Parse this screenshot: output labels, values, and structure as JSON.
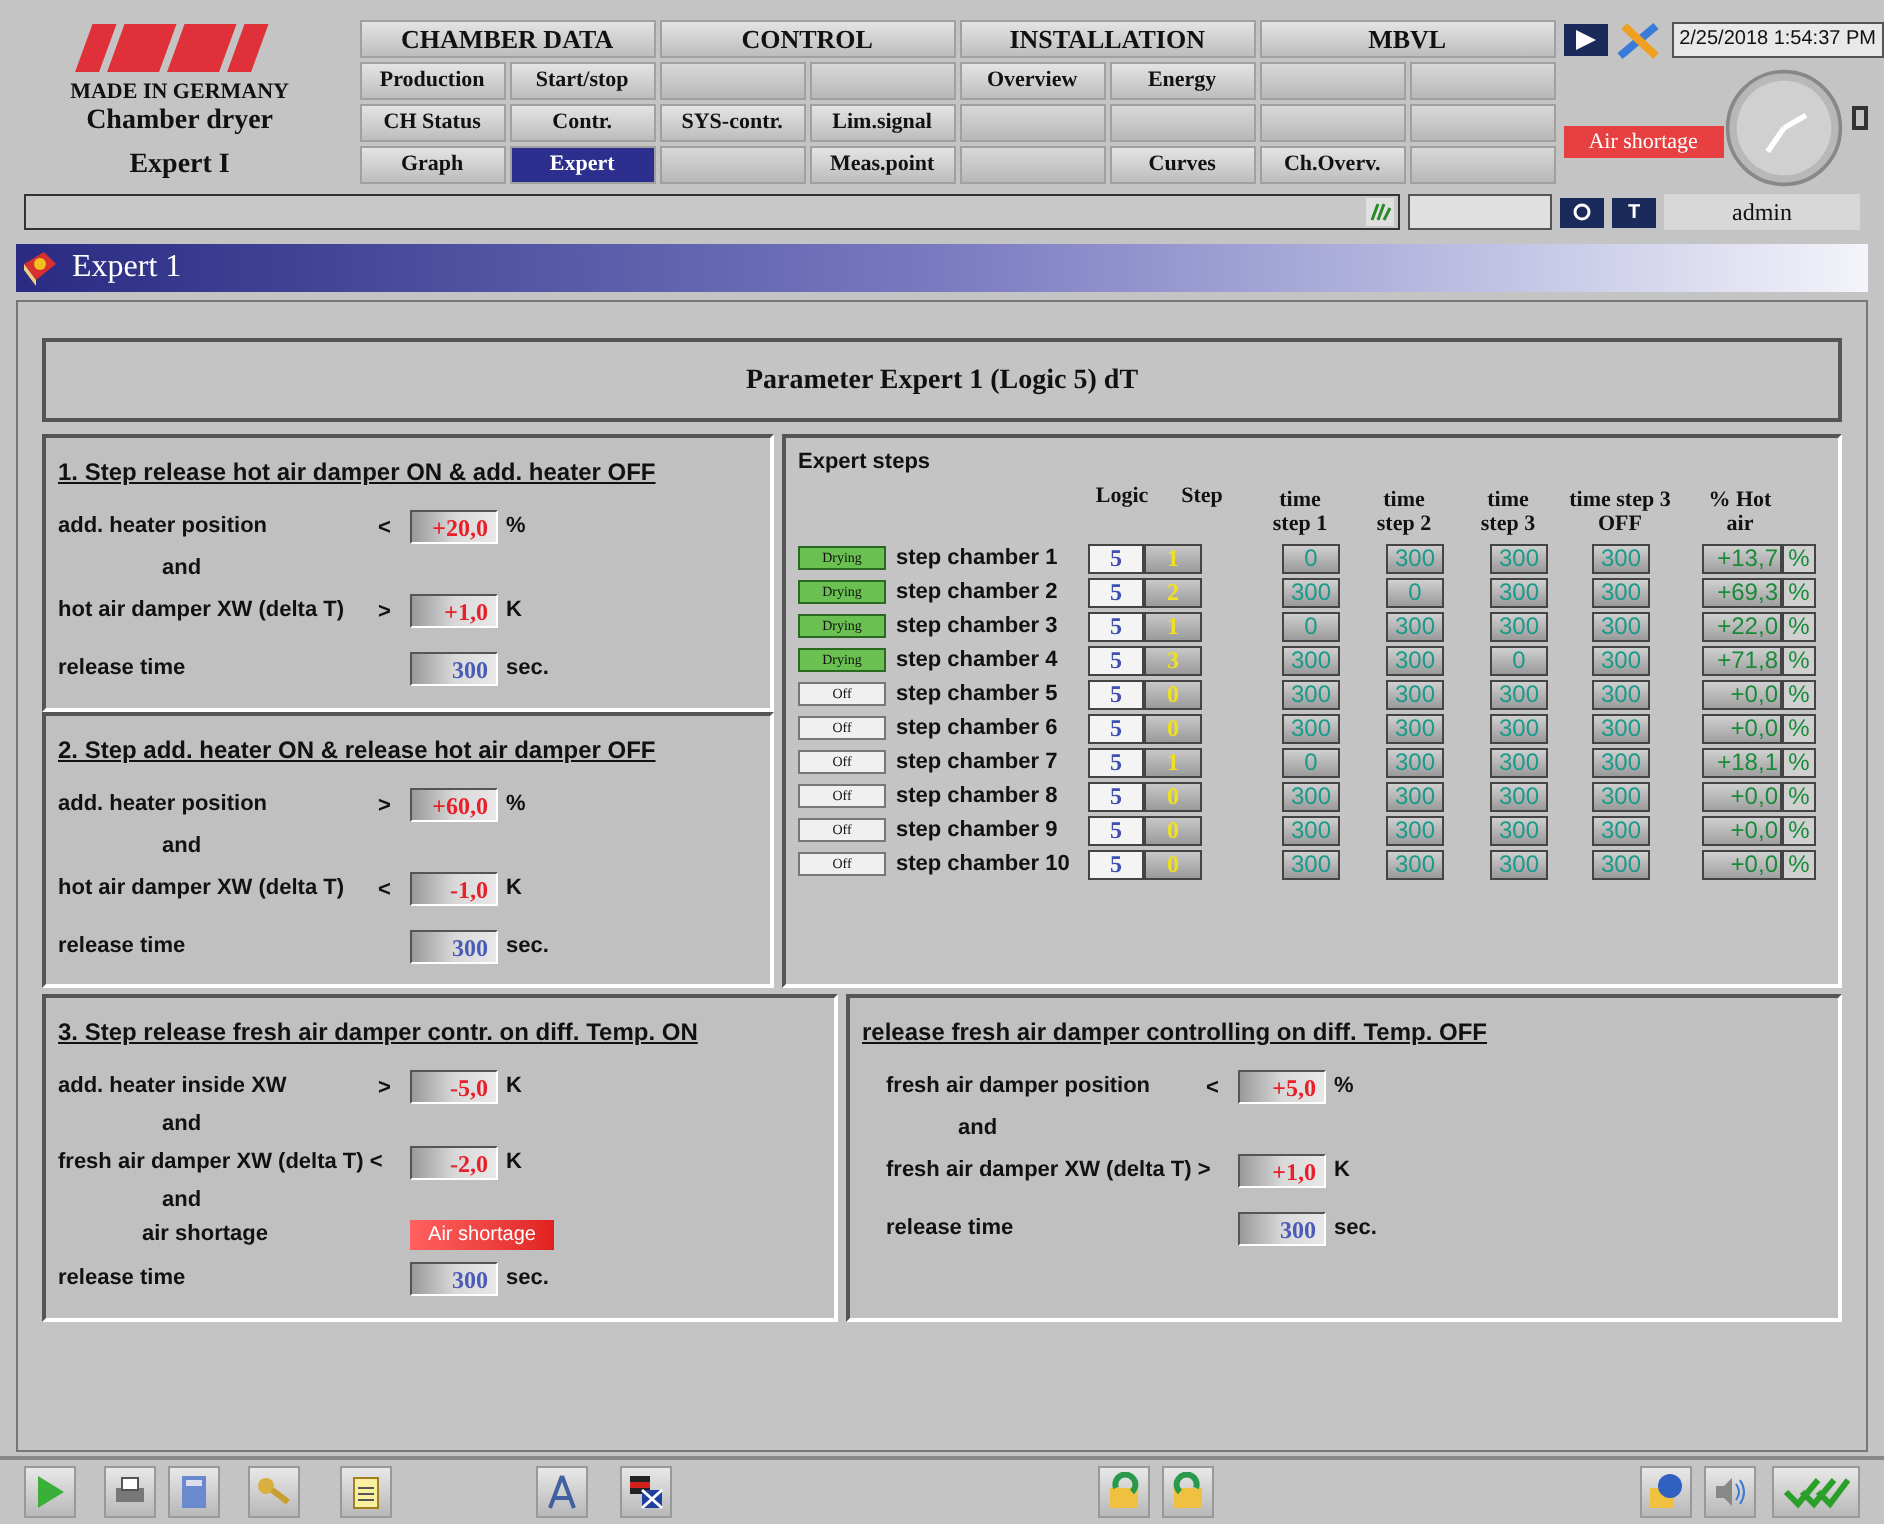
{
  "header": {
    "made_in": "MADE IN GERMANY",
    "machine": "Chamber dryer",
    "page": "Expert I"
  },
  "nav": [
    {
      "title": "CHAMBER DATA",
      "cells": [
        {
          "label": "Production",
          "selected": false
        },
        {
          "label": "Start/stop",
          "selected": false
        },
        {
          "label": "CH Status",
          "selected": false
        },
        {
          "label": "Contr.",
          "selected": false
        },
        {
          "label": "Graph",
          "selected": false
        },
        {
          "label": "Expert",
          "selected": true
        }
      ]
    },
    {
      "title": "CONTROL",
      "cells": [
        null,
        null,
        {
          "label": "SYS-contr.",
          "selected": false
        },
        {
          "label": "Lim.signal",
          "selected": false
        },
        null,
        {
          "label": "Meas.point",
          "selected": false
        }
      ]
    },
    {
      "title": "INSTALLATION",
      "cells": [
        {
          "label": "Overview",
          "selected": false
        },
        {
          "label": "Energy",
          "selected": false
        },
        null,
        null,
        null,
        {
          "label": "Curves",
          "selected": false
        }
      ]
    },
    {
      "title": "MBVL",
      "cells": [
        null,
        null,
        null,
        null,
        {
          "label": "Ch.Overv.",
          "selected": false
        },
        null
      ]
    }
  ],
  "datetime": "2/25/2018 1:54:37 PM",
  "alarm": "Air shortage",
  "user": "admin",
  "key_label": "T",
  "window_title": "Expert 1",
  "parameter_title": "Parameter Expert 1 (Logic 5) dT",
  "panels": [
    {
      "title": "1. Step release hot air damper ON & add. heater OFF",
      "rows": [
        {
          "label": "add. heater position",
          "op": "<",
          "value": "+20,0",
          "unit": "%",
          "kind": "limit"
        },
        {
          "kind": "and",
          "label": "and"
        },
        {
          "label": "hot air damper XW (delta T)",
          "op": ">",
          "value": "+1,0",
          "unit": "K",
          "kind": "limit"
        },
        {
          "label": "release time",
          "value": "300",
          "unit": "sec.",
          "kind": "time"
        }
      ]
    },
    {
      "title": "2. Step add. heater ON & release hot air damper OFF",
      "rows": [
        {
          "label": "add. heater position",
          "op": ">",
          "value": "+60,0",
          "unit": "%",
          "kind": "limit"
        },
        {
          "kind": "and",
          "label": "and"
        },
        {
          "label": "hot air damper XW (delta T)",
          "op": "<",
          "value": "-1,0",
          "unit": "K",
          "kind": "limit"
        },
        {
          "label": "release time",
          "value": "300",
          "unit": "sec.",
          "kind": "time"
        }
      ]
    },
    {
      "title": "3. Step release fresh air damper contr. on diff. Temp. ON",
      "rows": [
        {
          "label": "add. heater inside XW",
          "op": ">",
          "value": "-5,0",
          "unit": "K",
          "kind": "limit"
        },
        {
          "kind": "and",
          "label": "and"
        },
        {
          "label": "fresh air damper XW (delta T) <",
          "value": "-2,0",
          "unit": "K",
          "kind": "limit"
        },
        {
          "kind": "and",
          "label": "and"
        },
        {
          "kind": "alarm",
          "label": "air shortage",
          "value": "Air shortage"
        },
        {
          "label": "release time",
          "value": "300",
          "unit": "sec.",
          "kind": "time"
        }
      ]
    },
    {
      "title": "release fresh air damper controlling on diff. Temp. OFF",
      "rows": [
        {
          "label": "fresh air damper position",
          "op": "<",
          "value": "+5,0",
          "unit": "%",
          "kind": "limit"
        },
        {
          "kind": "and",
          "label": "and"
        },
        {
          "label": "fresh air damper XW (delta T) >",
          "value": "+1,0",
          "unit": "K",
          "kind": "limit"
        },
        {
          "label": "release time",
          "value": "300",
          "unit": "sec.",
          "kind": "time"
        }
      ]
    }
  ],
  "expert_steps": {
    "title": "Expert steps",
    "columns": [
      "Logic",
      "Step",
      "time step 1",
      "time step 2",
      "time step 3",
      "time step 3 OFF",
      "% Hot air"
    ],
    "rows": [
      {
        "status": "Drying",
        "drying": true,
        "name": "step chamber 1",
        "logic": "5",
        "step": "1",
        "t1": "0",
        "t2": "300",
        "t3": "300",
        "t3off": "300",
        "hot_air": "+13,7",
        "unit": "%"
      },
      {
        "status": "Drying",
        "drying": true,
        "name": "step chamber 2",
        "logic": "5",
        "step": "2",
        "t1": "300",
        "t2": "0",
        "t3": "300",
        "t3off": "300",
        "hot_air": "+69,3",
        "unit": "%"
      },
      {
        "status": "Drying",
        "drying": true,
        "name": "step chamber 3",
        "logic": "5",
        "step": "1",
        "t1": "0",
        "t2": "300",
        "t3": "300",
        "t3off": "300",
        "hot_air": "+22,0",
        "unit": "%"
      },
      {
        "status": "Drying",
        "drying": true,
        "name": "step chamber 4",
        "logic": "5",
        "step": "3",
        "t1": "300",
        "t2": "300",
        "t3": "0",
        "t3off": "300",
        "hot_air": "+71,8",
        "unit": "%"
      },
      {
        "status": "Off",
        "drying": false,
        "name": "step chamber 5",
        "logic": "5",
        "step": "0",
        "t1": "300",
        "t2": "300",
        "t3": "300",
        "t3off": "300",
        "hot_air": "+0,0",
        "unit": "%"
      },
      {
        "status": "Off",
        "drying": false,
        "name": "step chamber 6",
        "logic": "5",
        "step": "0",
        "t1": "300",
        "t2": "300",
        "t3": "300",
        "t3off": "300",
        "hot_air": "+0,0",
        "unit": "%"
      },
      {
        "status": "Off",
        "drying": false,
        "name": "step chamber 7",
        "logic": "5",
        "step": "1",
        "t1": "0",
        "t2": "300",
        "t3": "300",
        "t3off": "300",
        "hot_air": "+18,1",
        "unit": "%"
      },
      {
        "status": "Off",
        "drying": false,
        "name": "step chamber 8",
        "logic": "5",
        "step": "0",
        "t1": "300",
        "t2": "300",
        "t3": "300",
        "t3off": "300",
        "hot_air": "+0,0",
        "unit": "%"
      },
      {
        "status": "Off",
        "drying": false,
        "name": "step chamber 9",
        "logic": "5",
        "step": "0",
        "t1": "300",
        "t2": "300",
        "t3": "300",
        "t3off": "300",
        "hot_air": "+0,0",
        "unit": "%"
      },
      {
        "status": "Off",
        "drying": false,
        "name": "step chamber 10",
        "logic": "5",
        "step": "0",
        "t1": "300",
        "t2": "300",
        "t3": "300",
        "t3off": "300",
        "hot_air": "+0,0",
        "unit": "%"
      }
    ]
  }
}
